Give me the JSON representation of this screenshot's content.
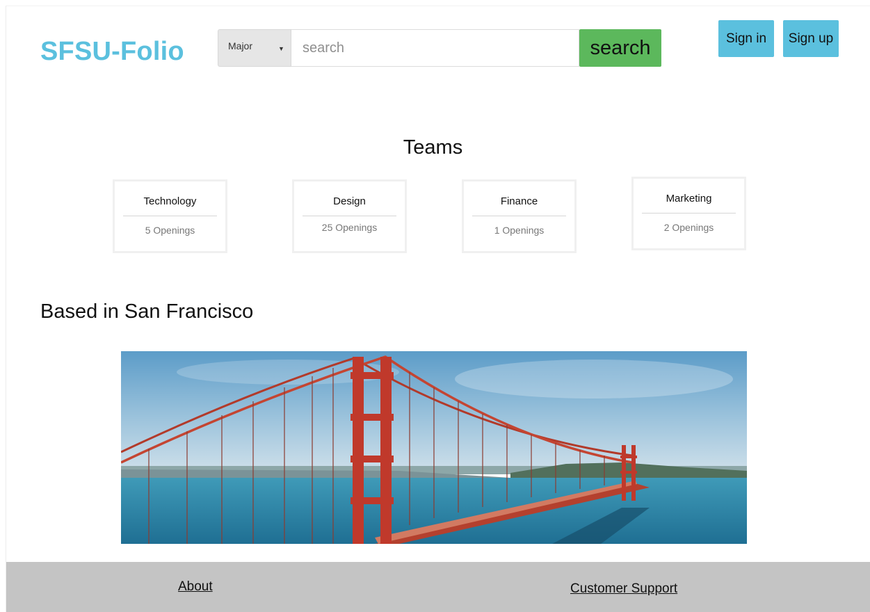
{
  "header": {
    "logo": "SFSU-Folio",
    "search": {
      "category_selected": "Major",
      "placeholder": "search",
      "value": "",
      "button_label": "search"
    },
    "sign_in_label": "Sign in",
    "sign_up_label": "Sign up"
  },
  "teams": {
    "title": "Teams",
    "items": [
      {
        "name": "Technology",
        "openings": "5 Openings"
      },
      {
        "name": "Design",
        "openings": "25 Openings"
      },
      {
        "name": "Finance",
        "openings": "1 Openings"
      },
      {
        "name": "Marketing",
        "openings": "2 Openings"
      }
    ]
  },
  "location": {
    "title": "Based in San Francisco"
  },
  "footer": {
    "about_label": "About",
    "support_label": "Customer Support"
  },
  "colors": {
    "brand": "#5bc0de",
    "search_button": "#5cb85c",
    "footer_bg": "#c4c4c4"
  }
}
